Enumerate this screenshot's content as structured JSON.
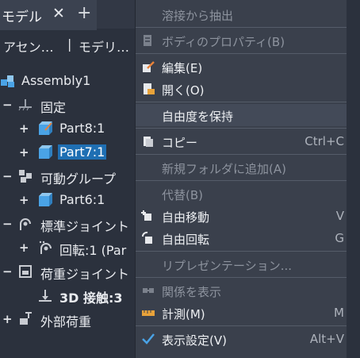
{
  "tabbar": {
    "tab_label": "モデル",
    "close_glyph": "✕",
    "add_glyph": "+"
  },
  "subtabs": {
    "assembly": "アセン…",
    "divider": "|",
    "model": "モデリ…"
  },
  "tree": {
    "root": "Assembly1",
    "fixed": "固定",
    "part8": "Part8:1",
    "part7": "Part7:1",
    "movable_group": "可動グループ",
    "part6": "Part6:1",
    "std_joint": "標準ジョイント",
    "rotation": "回転:1 (Par",
    "load_joint": "荷重ジョイント",
    "contact": "3D 接触:3",
    "external_load": "外部荷重"
  },
  "menu": {
    "items": [
      {
        "label": "溶接から抽出",
        "shortcut": "",
        "enabled": false,
        "icon": "none"
      },
      {
        "label": "ボディのプロパティ(B)",
        "shortcut": "",
        "enabled": false,
        "icon": "properties-icon"
      },
      {
        "label": "編集(E)",
        "shortcut": "",
        "enabled": true,
        "icon": "edit-icon"
      },
      {
        "label": "開く(O)",
        "shortcut": "",
        "enabled": true,
        "icon": "open-icon"
      },
      {
        "label": "自由度を保持",
        "shortcut": "",
        "enabled": true,
        "icon": "none"
      },
      {
        "label": "コピー",
        "shortcut": "Ctrl+C",
        "enabled": true,
        "icon": "copy-icon"
      },
      {
        "label": "新規フォルダに追加(A)",
        "shortcut": "",
        "enabled": false,
        "icon": "none"
      },
      {
        "label": "代替(B)",
        "shortcut": "",
        "enabled": false,
        "icon": "none"
      },
      {
        "label": "自由移動",
        "shortcut": "V",
        "enabled": true,
        "icon": "free-move-icon"
      },
      {
        "label": "自由回転",
        "shortcut": "G",
        "enabled": true,
        "icon": "free-rotate-icon"
      },
      {
        "label": "リプレゼンテーション...",
        "shortcut": "",
        "enabled": false,
        "icon": "none"
      },
      {
        "label": "関係を表示",
        "shortcut": "",
        "enabled": false,
        "icon": "relations-icon"
      },
      {
        "label": "計測(M)",
        "shortcut": "M",
        "enabled": true,
        "icon": "measure-icon"
      },
      {
        "label": "表示設定(V)",
        "shortcut": "Alt+V",
        "enabled": true,
        "icon": "check-icon"
      }
    ]
  },
  "colors": {
    "panel_bg": "#2b313d",
    "menu_bg": "#3a404c",
    "selection": "#1f6fb3",
    "accent_blue": "#4aa3e6"
  }
}
